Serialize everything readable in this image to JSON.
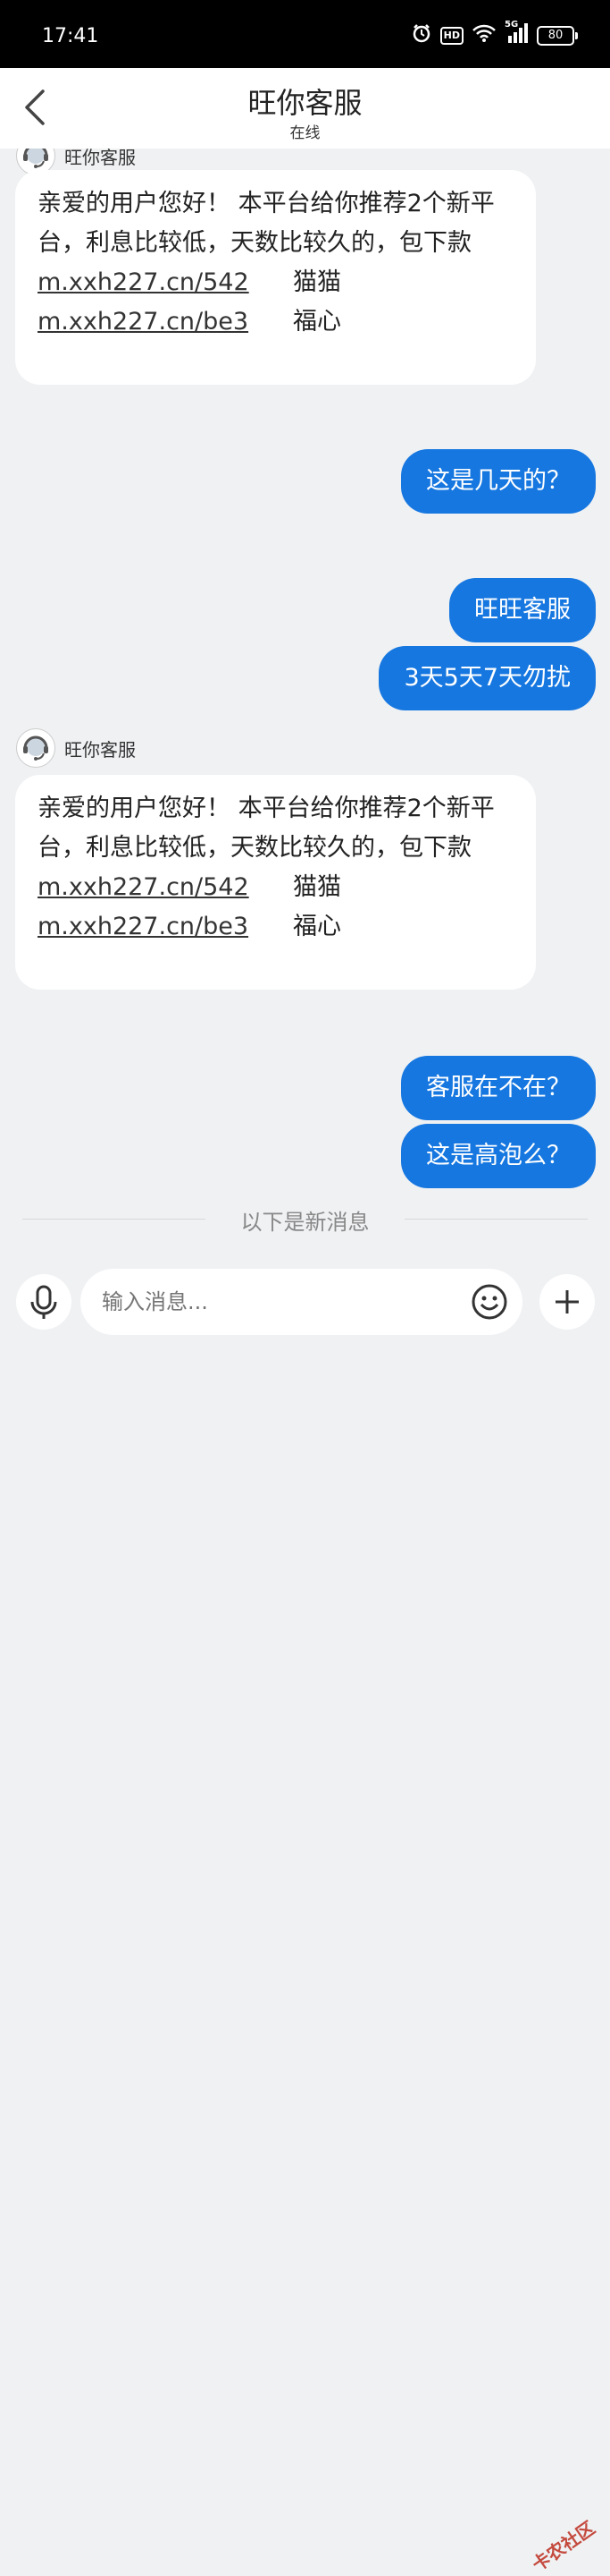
{
  "status_bar": {
    "time": "17:41",
    "hd_label": "HD",
    "network_label": "5G",
    "battery": "80"
  },
  "header": {
    "title": "旺你客服",
    "subtitle": "在线"
  },
  "messages": [
    {
      "from": "agent",
      "sender": "旺你客服",
      "text": "亲爱的用户您好！ 本平台给你推荐2个新平台，利息比较低，天数比较久的，包下款",
      "links": [
        {
          "url": "m.xxh227.cn/542",
          "name": "猫猫"
        },
        {
          "url": "m.xxh227.cn/be3",
          "name": "福心"
        }
      ]
    },
    {
      "from": "user",
      "text": "这是几天的？"
    },
    {
      "from": "user",
      "text": "旺旺客服"
    },
    {
      "from": "user",
      "text": "3天5天7天勿扰"
    },
    {
      "from": "agent",
      "sender": "旺你客服",
      "text": "亲爱的用户您好！ 本平台给你推荐2个新平台，利息比较低，天数比较久的，包下款",
      "links": [
        {
          "url": "m.xxh227.cn/542",
          "name": "猫猫"
        },
        {
          "url": "m.xxh227.cn/be3",
          "name": "福心"
        }
      ]
    },
    {
      "from": "user",
      "text": "客服在不在？"
    },
    {
      "from": "user",
      "text": "这是高泡么？"
    }
  ],
  "divider_text": "以下是新消息",
  "input": {
    "placeholder": "输入消息..."
  },
  "watermark": "卡农社区",
  "colors": {
    "accent": "#1677e0",
    "background": "#eff1f3"
  }
}
